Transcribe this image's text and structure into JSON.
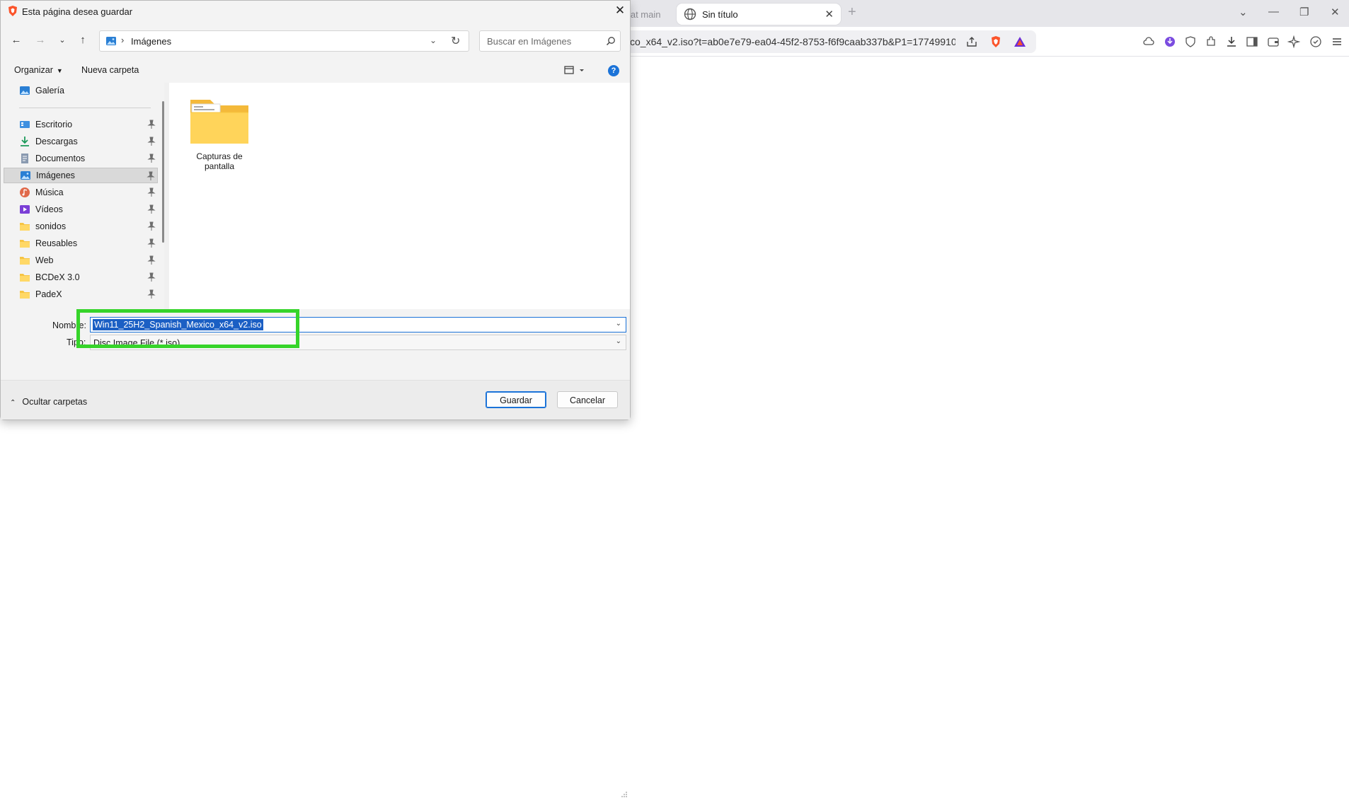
{
  "browser": {
    "tabs": [
      {
        "label": "n at main",
        "active": false
      },
      {
        "label": "Sin título",
        "active": true
      }
    ],
    "url": "co_x64_v2.iso?t=ab0e7e79-ea04-45f2-8753-f6f9caab337b&P1=17749910...",
    "icons": [
      "share-icon",
      "brave-shield-icon",
      "brave-rewards-icon",
      "cloud-icon",
      "vpn-icon",
      "shield-icon",
      "extensions-icon",
      "download-icon",
      "sidebar-icon",
      "wallet-icon",
      "leo-ai-icon",
      "brave-vpn-icon",
      "menu-icon"
    ]
  },
  "dialog": {
    "title": "Esta página desea guardar",
    "address": {
      "location": "Imágenes"
    },
    "search": {
      "placeholder": "Buscar en Imágenes"
    },
    "toolbar": {
      "organize_label": "Organizar",
      "new_folder_label": "Nueva carpeta"
    },
    "nav": {
      "items": [
        {
          "label": "Galería",
          "icon": "gallery-icon",
          "pinned": false
        },
        {
          "label": "Escritorio",
          "icon": "desktop-icon",
          "pinned": true
        },
        {
          "label": "Descargas",
          "icon": "downloads-icon",
          "pinned": true
        },
        {
          "label": "Documentos",
          "icon": "documents-icon",
          "pinned": true
        },
        {
          "label": "Imágenes",
          "icon": "pictures-icon",
          "pinned": true,
          "selected": true
        },
        {
          "label": "Música",
          "icon": "music-icon",
          "pinned": true
        },
        {
          "label": "Vídeos",
          "icon": "videos-icon",
          "pinned": true
        },
        {
          "label": "sonidos",
          "icon": "folder-icon",
          "pinned": true
        },
        {
          "label": "Reusables",
          "icon": "folder-icon",
          "pinned": true
        },
        {
          "label": "Web",
          "icon": "folder-icon",
          "pinned": true
        },
        {
          "label": "BCDeX 3.0",
          "icon": "folder-icon",
          "pinned": true
        },
        {
          "label": "PadeX",
          "icon": "folder-icon",
          "pinned": true
        }
      ]
    },
    "content": {
      "folders": [
        {
          "label": "Capturas de pantalla"
        }
      ]
    },
    "fields": {
      "name_label": "Nombre:",
      "name_value": "Win11_25H2_Spanish_Mexico_x64_v2.iso",
      "type_label": "Tipo:",
      "type_value": "Disc Image File (*.iso)"
    },
    "footer": {
      "hide_folders_label": "Ocultar carpetas",
      "save_label": "Guardar",
      "cancel_label": "Cancelar"
    }
  },
  "colors": {
    "highlight": "#36d42a",
    "selection": "#1b5fc4",
    "accent": "#1b73d8"
  }
}
